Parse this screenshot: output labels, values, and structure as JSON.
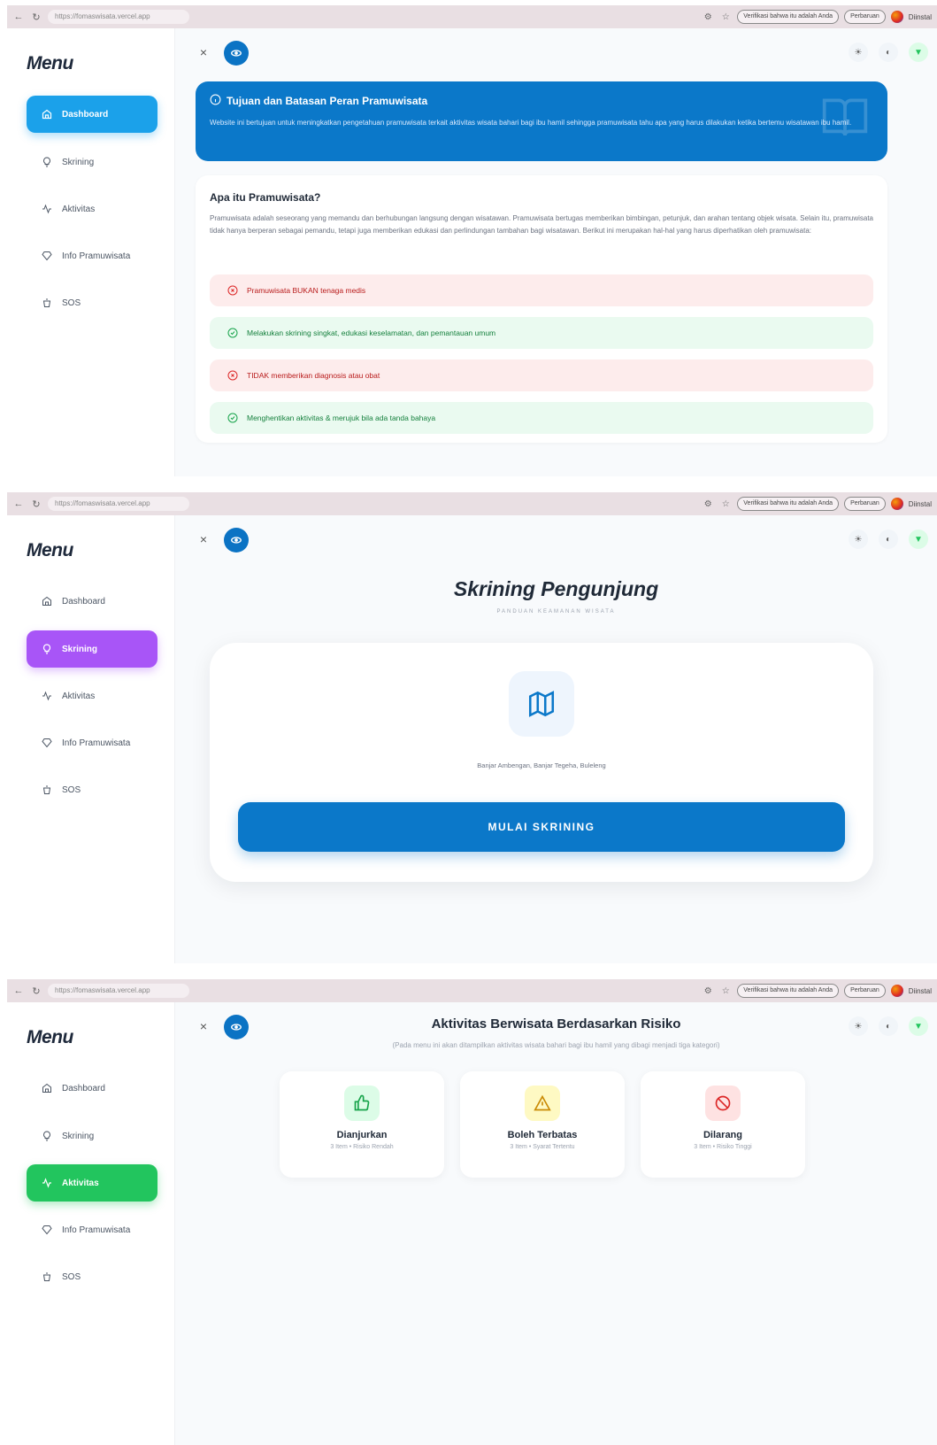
{
  "browser": {
    "url": "https://fomaswisata.vercel.app",
    "verify_pill": "Verifikasi bahwa itu adalah Anda",
    "update_pill": "Perbaruan",
    "profile_label": "Diinstal"
  },
  "sidebar": {
    "title": "Menu",
    "items": [
      {
        "label": "Dashboard",
        "icon": "home-icon"
      },
      {
        "label": "Skrining",
        "icon": "bulb-icon"
      },
      {
        "label": "Aktivitas",
        "icon": "activity-icon"
      },
      {
        "label": "Info Pramuwisata",
        "icon": "diamond-icon"
      },
      {
        "label": "SOS",
        "icon": "sos-icon"
      }
    ]
  },
  "colors": {
    "primary": "#0b78c9",
    "dashboard_active": "#1ba1ea",
    "skrining_active": "#a855f7",
    "aktivitas_active": "#22c55e",
    "danger": "#b91c1c",
    "success": "#15803d",
    "warning": "#eab308"
  },
  "dashboard": {
    "banner_title": "Tujuan dan Batasan Peran Pramuwisata",
    "banner_desc": "Website ini bertujuan untuk meningkatkan pengetahuan pramuwisata terkait aktivitas wisata bahari bagi ibu hamil sehingga pramuwisata tahu apa yang harus dilakukan ketika bertemu wisatawan ibu hamil.",
    "card_title": "Apa itu Pramuwisata?",
    "card_desc": "Pramuwisata adalah seseorang yang memandu dan berhubungan langsung dengan wisatawan. Pramuwisata bertugas memberikan bimbingan, petunjuk, dan arahan tentang objek wisata. Selain itu, pramuwisata tidak hanya berperan sebagai pemandu, tetapi juga memberikan edukasi dan perlindungan tambahan bagi wisatawan. Berikut ini merupakan hal-hal yang harus diperhatikan oleh pramuwisata:",
    "rules": [
      {
        "text": "Pramuwisata BUKAN tenaga medis",
        "type": "red"
      },
      {
        "text": "Melakukan skrining singkat, edukasi keselamatan, dan pemantauan umum",
        "type": "green"
      },
      {
        "text": "TIDAK memberikan diagnosis atau obat",
        "type": "red"
      },
      {
        "text": "Menghentikan aktivitas & merujuk bila ada tanda bahaya",
        "type": "green"
      }
    ]
  },
  "skrining": {
    "title": "Skrining Pengunjung",
    "subtitle": "PANDUAN KEAMANAN WISATA",
    "location": "Banjar Ambengan, Banjar Tegeha, Buleleng",
    "button": "MULAI SKRINING"
  },
  "aktivitas": {
    "title": "Aktivitas Berwisata Berdasarkan Risiko",
    "subtitle": "(Pada menu ini akan ditampilkan aktivitas wisata bahari bagi ibu hamil yang dibagi menjadi tiga kategori)",
    "categories": [
      {
        "name": "Dianjurkan",
        "meta": "3 Item • Risiko Rendah",
        "icon": "thumbs-up-icon",
        "color": "#22c55e"
      },
      {
        "name": "Boleh Terbatas",
        "meta": "3 Item • Syarat Tertentu",
        "icon": "warning-icon",
        "color": "#eab308"
      },
      {
        "name": "Dilarang",
        "meta": "3 Item • Risiko Tinggi",
        "icon": "ban-icon",
        "color": "#ef4444"
      }
    ]
  }
}
